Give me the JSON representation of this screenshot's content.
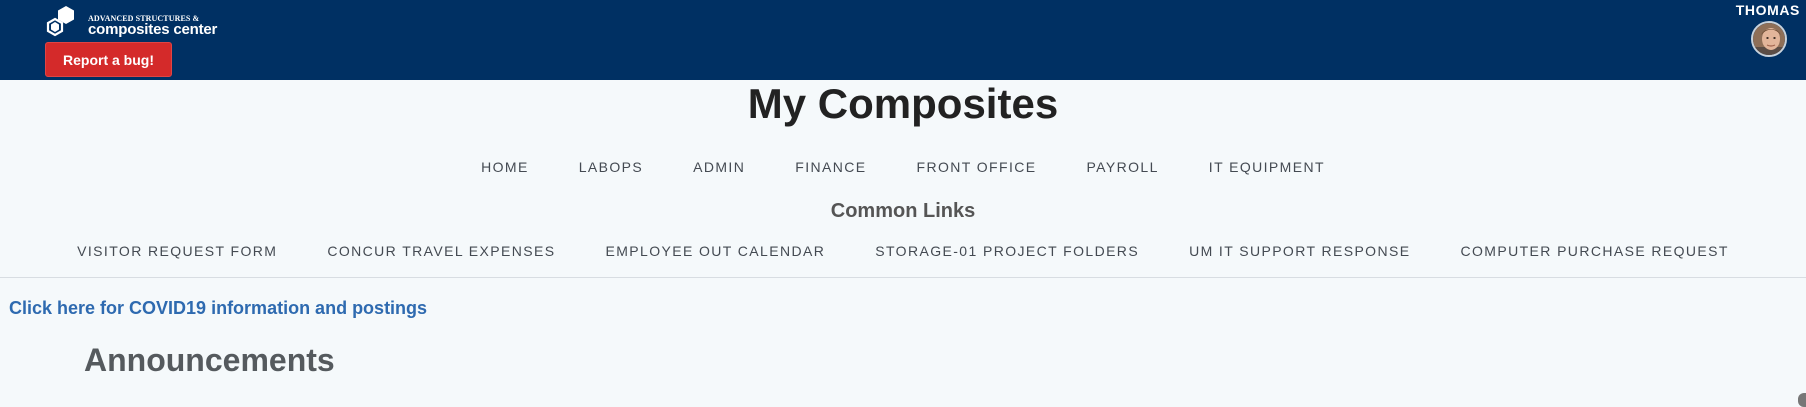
{
  "header": {
    "logo_line1": "ADVANCED STRUCTURES &",
    "logo_line2": "composites center",
    "bug_button_label": "Report a bug!",
    "user_name": "THOMAS",
    "background_color": "#003063",
    "bug_button_color": "#d42a2a"
  },
  "page": {
    "title": "My Composites"
  },
  "nav": {
    "items": [
      {
        "label": "HOME"
      },
      {
        "label": "LABOPS"
      },
      {
        "label": "ADMIN"
      },
      {
        "label": "FINANCE"
      },
      {
        "label": "FRONT OFFICE"
      },
      {
        "label": "PAYROLL"
      },
      {
        "label": "IT EQUIPMENT"
      }
    ]
  },
  "common_links": {
    "title": "Common Links",
    "items": [
      {
        "label": "VISITOR REQUEST FORM"
      },
      {
        "label": "CONCUR TRAVEL EXPENSES"
      },
      {
        "label": "EMPLOYEE OUT CALENDAR"
      },
      {
        "label": "STORAGE-01 PROJECT FOLDERS"
      },
      {
        "label": "UM IT SUPPORT RESPONSE"
      },
      {
        "label": "COMPUTER PURCHASE REQUEST"
      }
    ]
  },
  "content": {
    "covid_link": "Click here for COVID19 information and postings",
    "announcements_heading": "Announcements",
    "link_color": "#2e6ab0"
  }
}
